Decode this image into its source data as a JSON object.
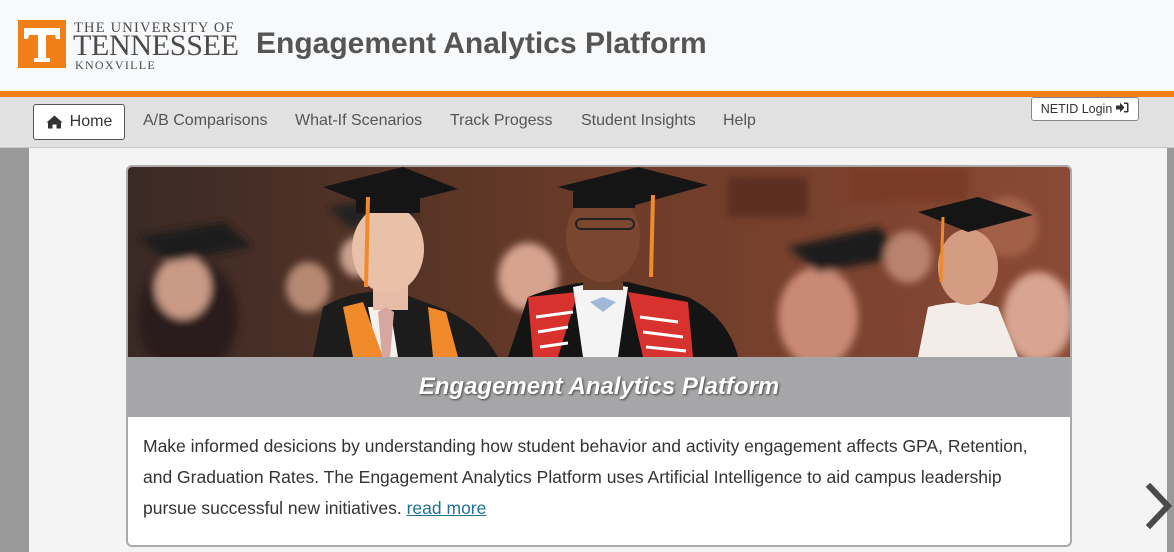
{
  "header": {
    "logo": {
      "line1": "THE UNIVERSITY OF",
      "line2": "TENNESSEE",
      "line3": "KNOXVILLE",
      "mark": "T"
    },
    "title": "Engagement Analytics Platform"
  },
  "nav": {
    "home": {
      "label": "Home",
      "icon": "home-icon"
    },
    "items": [
      {
        "label": "A/B Comparisons"
      },
      {
        "label": "What-If Scenarios"
      },
      {
        "label": "Track Progess"
      },
      {
        "label": "Student Insights"
      },
      {
        "label": "Help"
      }
    ],
    "login": {
      "label": "NETID Login",
      "icon": "sign-in-icon"
    }
  },
  "carousel": {
    "caption_title": "Engagement Analytics Platform",
    "body_text": "Make informed desicions by understanding how student behavior and activity engagement affects GPA, Retention, and Graduation Rates. The Engagement Analytics Platform uses Artificial Intelligence to aid campus leadership pursue successful new initiatives.",
    "read_more": "read more",
    "next_icon": "chevron-right-icon"
  },
  "colors": {
    "brand_orange": "#f07f18",
    "nav_background": "#e1e1e1",
    "caption_gray": "#a6a6a8",
    "link": "#1d7293"
  }
}
